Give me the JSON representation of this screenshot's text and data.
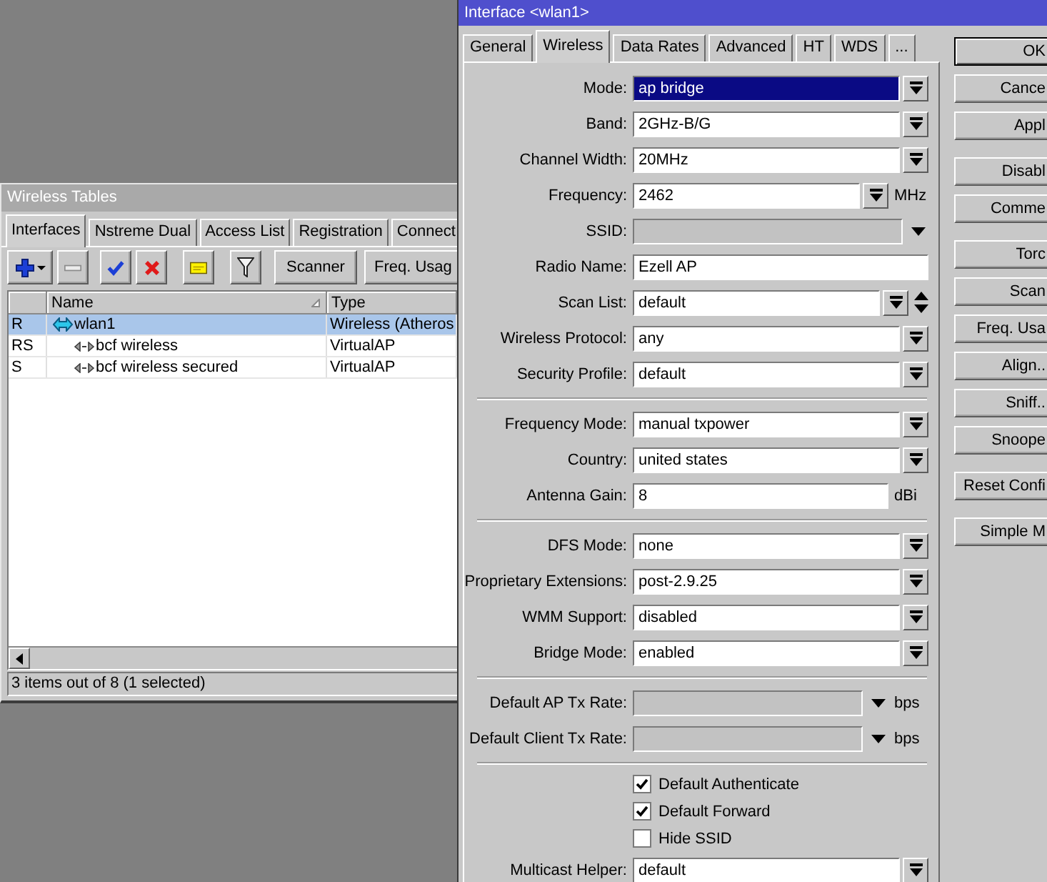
{
  "tables_window": {
    "title": "Wireless Tables",
    "tabs": [
      {
        "label": "Interfaces",
        "selected": true
      },
      {
        "label": "Nstreme Dual",
        "selected": false
      },
      {
        "label": "Access List",
        "selected": false
      },
      {
        "label": "Registration",
        "selected": false
      },
      {
        "label": "Connect",
        "selected": false
      }
    ],
    "toolbar_buttons": [
      "Scanner",
      "Freq. Usag"
    ],
    "table": {
      "columns": [
        {
          "label": "Name",
          "sorted": true
        },
        {
          "label": "Type",
          "sorted": false
        }
      ],
      "rows": [
        {
          "column_1": "R",
          "name": "wlan1",
          "type": "Wireless (Atheros",
          "selected": true,
          "children": [
            {
              "column_1": "RS",
              "name": "bcf wireless",
              "type": "VirtualAP",
              "selected": false
            },
            {
              "column_1": "S",
              "name": "bcf wireless secured",
              "type": "VirtualAP",
              "selected": false
            }
          ]
        }
      ]
    },
    "status_bar": "3 items out of 8 (1 selected)"
  },
  "interface_dialog": {
    "title": "Interface <wlan1>",
    "tabs": [
      {
        "label": "General",
        "selected": false
      },
      {
        "label": "Wireless",
        "selected": true
      },
      {
        "label": "Data Rates",
        "selected": false
      },
      {
        "label": "Advanced",
        "selected": false
      },
      {
        "label": "HT",
        "selected": false
      },
      {
        "label": "WDS",
        "selected": false
      },
      {
        "label": "...",
        "selected": false
      }
    ],
    "sections": [
      {
        "fields": [
          {
            "kind": "select",
            "label": "Mode:",
            "value": "ap bridge",
            "focused": true,
            "disabled": false
          },
          {
            "kind": "select",
            "label": "Band:",
            "value": "2GHz-B/G",
            "focused": false,
            "disabled": false
          },
          {
            "kind": "select",
            "label": "Channel Width:",
            "value": "20MHz",
            "focused": false,
            "disabled": false
          },
          {
            "kind": "select",
            "label": "Frequency:",
            "value": "2462",
            "unit": "MHz",
            "focused": false,
            "disabled": false
          },
          {
            "kind": "combo",
            "label": "SSID:",
            "focused": false,
            "disabled": true
          },
          {
            "kind": "input",
            "label": "Radio Name:",
            "value": "Ezell AP",
            "focused": false,
            "disabled": false
          },
          {
            "kind": "list",
            "label": "Scan List:",
            "value": "default",
            "focused": false,
            "disabled": false
          },
          {
            "kind": "select",
            "label": "Wireless Protocol:",
            "value": "any",
            "focused": false,
            "disabled": false
          },
          {
            "kind": "select",
            "label": "Security Profile:",
            "value": "default",
            "focused": false,
            "disabled": false
          }
        ]
      },
      {
        "fields": [
          {
            "kind": "select",
            "label": "Frequency Mode:",
            "value": "manual txpower",
            "focused": false,
            "disabled": false
          },
          {
            "kind": "select",
            "label": "Country:",
            "value": "united states",
            "focused": false,
            "disabled": false
          },
          {
            "kind": "input",
            "label": "Antenna Gain:",
            "value": "8",
            "unit": "dBi",
            "focused": false,
            "disabled": false
          }
        ]
      },
      {
        "fields": [
          {
            "kind": "select",
            "label": "DFS Mode:",
            "value": "none",
            "focused": false,
            "disabled": false
          },
          {
            "kind": "select",
            "label": "Proprietary Extensions:",
            "value": "post-2.9.25",
            "focused": false,
            "disabled": false
          },
          {
            "kind": "select",
            "label": "WMM Support:",
            "value": "disabled",
            "focused": false,
            "disabled": false
          },
          {
            "kind": "select",
            "label": "Bridge Mode:",
            "value": "enabled",
            "focused": false,
            "disabled": false
          }
        ]
      },
      {
        "fields": [
          {
            "kind": "combo",
            "label": "Default AP Tx Rate:",
            "unit": "bps",
            "focused": false,
            "disabled": true
          },
          {
            "kind": "combo",
            "label": "Default Client Tx Rate:",
            "unit": "bps",
            "focused": false,
            "disabled": true
          }
        ]
      },
      {
        "fields": [
          {
            "kind": "checkbox",
            "label": "Default Authenticate",
            "checked": true
          },
          {
            "kind": "checkbox",
            "label": "Default Forward",
            "checked": true
          },
          {
            "kind": "checkbox",
            "label": "Hide SSID",
            "checked": false
          },
          {
            "kind": "select",
            "label": "Multicast Helper:",
            "value": "default",
            "focused": false,
            "disabled": false
          }
        ]
      }
    ],
    "buttons": [
      [
        {
          "label": "OK",
          "default": true
        },
        {
          "label": "Cance",
          "default": false
        },
        {
          "label": "Appl",
          "default": false
        }
      ],
      [
        {
          "label": "Disabl",
          "default": false
        },
        {
          "label": "Comme",
          "default": false
        }
      ],
      [
        {
          "label": "Torc",
          "default": false
        },
        {
          "label": "Scan",
          "default": false
        },
        {
          "label": "Freq. Usa",
          "default": false
        },
        {
          "label": "Align..",
          "default": false
        },
        {
          "label": "Sniff..",
          "default": false
        },
        {
          "label": "Snoope",
          "default": false
        }
      ],
      [
        {
          "label": "Reset Confi",
          "default": false
        }
      ],
      [
        {
          "label": "Simple M",
          "default": false
        }
      ]
    ]
  }
}
